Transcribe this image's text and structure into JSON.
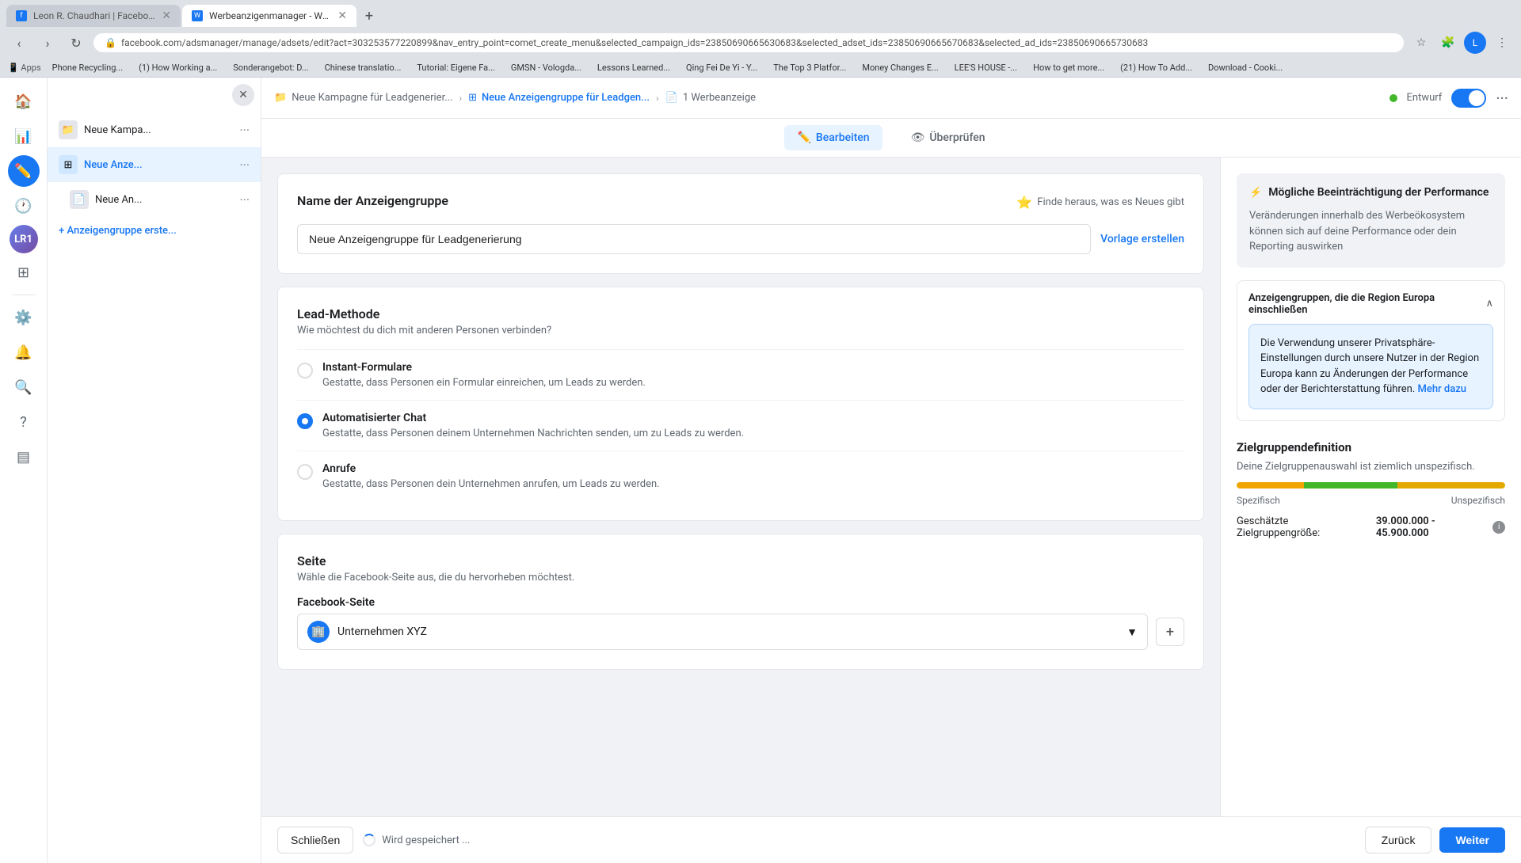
{
  "browser": {
    "tabs": [
      {
        "id": "tab1",
        "title": "Leon R. Chaudhari | Facebook",
        "active": false,
        "favicon": "F"
      },
      {
        "id": "tab2",
        "title": "Werbeanzigenmanager - Wer...",
        "active": true,
        "favicon": "W"
      }
    ],
    "new_tab_label": "+",
    "url": "facebook.com/adsmanager/manage/adsets/edit?act=303253577220899&nav_entry_point=comet_create_menu&selected_campaign_ids=23850690665630683&selected_adset_ids=23850690665670683&selected_ad_ids=23850690665730683",
    "bookmarks": [
      "Apps",
      "Phone Recycling...",
      "(1) How Working a...",
      "Sonderangebot: D...",
      "Chinese translatio...",
      "Tutorial: Eigene Fa...",
      "GMSN - Vologda...",
      "Lessons Learned ...",
      "Qing Fei De Yi - Y...",
      "The Top 3 Platfor...",
      "Money Changes E...",
      "LEE'S HOUSE -...",
      "How to get more ...",
      "(21) How To Add ...",
      "Download - Cooki..."
    ]
  },
  "sidebar": {
    "home_icon": "🏠",
    "chart_icon": "📊",
    "edit_icon": "✏️",
    "clock_icon": "🕐",
    "avatar_initials": "LR",
    "notification_count": "1",
    "grid_icon": "⊞",
    "settings_icon": "⚙️",
    "bell_icon": "🔔",
    "search_icon": "🔍",
    "help_icon": "?",
    "table_icon": "▤"
  },
  "campaign_panel": {
    "close_icon": "✕",
    "items": [
      {
        "icon": "📁",
        "label": "Neue Kampa...",
        "more": "···"
      },
      {
        "icon": "⊞",
        "label": "Neue Anze...",
        "more": "···",
        "type": "adgroup"
      },
      {
        "icon": "📄",
        "label": "Neue An...",
        "more": "···"
      }
    ],
    "add_group_label": "+ Anzeigengruppe erste..."
  },
  "top_nav": {
    "breadcrumbs": [
      {
        "icon": "📁",
        "label": "Neue Kampagne für Leadgenerier...",
        "active": false
      },
      {
        "icon": "⊞",
        "label": "Neue Anzeigengruppe für Leadgen...",
        "active": true
      },
      {
        "icon": "📄",
        "label": "1 Werbeanzeige",
        "active": false
      }
    ],
    "status_label": "Entwurf",
    "edit_tab": "Bearbeiten",
    "review_tab": "Überprüfen",
    "more_label": "···"
  },
  "form": {
    "ad_group_name_label": "Name der Anzeigengruppe",
    "discover_label": "Finde heraus, was es Neues gibt",
    "ad_group_name_value": "Neue Anzeigengruppe für Leadgenerierung",
    "template_label": "Vorlage erstellen",
    "lead_method_title": "Lead-Methode",
    "lead_method_subtitle": "Wie möchtest du dich mit anderen Personen verbinden?",
    "radio_options": [
      {
        "id": "instant",
        "label": "Instant-Formulare",
        "desc": "Gestatte, dass Personen ein Formular einreichen, um Leads zu werden.",
        "selected": false
      },
      {
        "id": "chat",
        "label": "Automatisierter Chat",
        "desc": "Gestatte, dass Personen deinem Unternehmen Nachrichten senden, um zu Leads zu werden.",
        "selected": true
      },
      {
        "id": "calls",
        "label": "Anrufe",
        "desc": "Gestatte, dass Personen dein Unternehmen anrufen, um Leads zu werden.",
        "selected": false
      }
    ],
    "seite_title": "Seite",
    "seite_subtitle": "Wähle die Facebook-Seite aus, die du hervorheben möchtest.",
    "facebook_seite_label": "Facebook-Seite",
    "page_value": "Unternehmen XYZ"
  },
  "right_panel": {
    "performance_title": "Mögliche Beeinträchtigung der Performance",
    "performance_text": "Veränderungen innerhalb des Werbeökosystem können sich auf deine Performance oder dein Reporting auswirken",
    "warning_title": "Anzeigengruppen, die die Region Europa einschließen",
    "warning_text": "Die Verwendung unserer Privatsphäre-Einstellungen durch unsere Nutzer in der Region Europa kann zu Änderungen der Performance oder der Berichterstattung führen.",
    "warning_link": "Mehr dazu",
    "audience_title": "Zielgruppendefinition",
    "audience_subtitle": "Deine Zielgruppenauswahl ist ziemlich unspezifisch.",
    "specific_label": "Spezifisch",
    "unspecific_label": "Unspezifisch",
    "est_size_label": "Geschätzte Zielgruppengröße:",
    "est_size_value": "39.000.000 - 45.900.000"
  },
  "bottom_bar": {
    "close_label": "Schließen",
    "saving_label": "Wird gespeichert ...",
    "back_label": "Zurück",
    "next_label": "Weiter"
  }
}
